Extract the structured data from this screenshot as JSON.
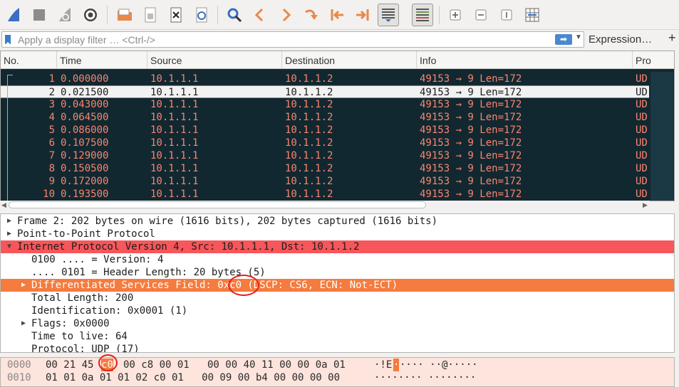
{
  "toolbar": {
    "buttons": [
      "shark-fin-start-icon",
      "stop-square-icon",
      "restart-fin-icon",
      "options-gear-icon",
      "open-folder-icon",
      "save-file-icon",
      "close-file-icon",
      "reload-icon",
      "find-magnifier-icon",
      "go-back-icon",
      "go-forward-icon",
      "go-to-packet-icon",
      "go-first-icon",
      "go-last-icon",
      "autoscroll-icon",
      "colorize-icon",
      "zoom-in-icon",
      "zoom-out-icon",
      "normal-size-icon",
      "resize-columns-icon"
    ]
  },
  "filter": {
    "placeholder": "Apply a display filter … <Ctrl-/>",
    "expression_label": "Expression…",
    "add_label": "+"
  },
  "packet_list": {
    "columns": [
      "No.",
      "Time",
      "Source",
      "Destination",
      "Info",
      "Pro"
    ],
    "rows": [
      {
        "no": "1",
        "time": "0.000000",
        "src": "10.1.1.1",
        "dst": "10.1.1.2",
        "info": "49153 → 9 Len=172",
        "proto": "UD"
      },
      {
        "no": "2",
        "time": "0.021500",
        "src": "10.1.1.1",
        "dst": "10.1.1.2",
        "info": "49153 → 9 Len=172",
        "proto": "UD"
      },
      {
        "no": "3",
        "time": "0.043000",
        "src": "10.1.1.1",
        "dst": "10.1.1.2",
        "info": "49153 → 9 Len=172",
        "proto": "UD"
      },
      {
        "no": "4",
        "time": "0.064500",
        "src": "10.1.1.1",
        "dst": "10.1.1.2",
        "info": "49153 → 9 Len=172",
        "proto": "UD"
      },
      {
        "no": "5",
        "time": "0.086000",
        "src": "10.1.1.1",
        "dst": "10.1.1.2",
        "info": "49153 → 9 Len=172",
        "proto": "UD"
      },
      {
        "no": "6",
        "time": "0.107500",
        "src": "10.1.1.1",
        "dst": "10.1.1.2",
        "info": "49153 → 9 Len=172",
        "proto": "UD"
      },
      {
        "no": "7",
        "time": "0.129000",
        "src": "10.1.1.1",
        "dst": "10.1.1.2",
        "info": "49153 → 9 Len=172",
        "proto": "UD"
      },
      {
        "no": "8",
        "time": "0.150500",
        "src": "10.1.1.1",
        "dst": "10.1.1.2",
        "info": "49153 → 9 Len=172",
        "proto": "UD"
      },
      {
        "no": "9",
        "time": "0.172000",
        "src": "10.1.1.1",
        "dst": "10.1.1.2",
        "info": "49153 → 9 Len=172",
        "proto": "UD"
      },
      {
        "no": "10",
        "time": "0.193500",
        "src": "10.1.1.1",
        "dst": "10.1.1.2",
        "info": "49153 → 9 Len=172",
        "proto": "UD"
      }
    ],
    "selected_no": "2"
  },
  "details": {
    "lines": [
      {
        "text": "Frame 2: 202 bytes on wire (1616 bits), 202 bytes captured (1616 bits)",
        "expander": "collapsed"
      },
      {
        "text": "Point-to-Point Protocol",
        "expander": "collapsed"
      },
      {
        "text": "Internet Protocol Version 4, Src: 10.1.1.1, Dst: 10.1.1.2",
        "expander": "expanded",
        "highlight": "red"
      },
      {
        "text": "0100 .... = Version: 4",
        "expander": "none"
      },
      {
        "text": ".... 0101 = Header Length: 20 bytes (5)",
        "expander": "none"
      },
      {
        "text": "Differentiated Services Field: 0xc0 (DSCP: CS6, ECN: Not-ECT)",
        "expander": "collapsed",
        "highlight": "orange"
      },
      {
        "text": "Total Length: 200",
        "expander": "none"
      },
      {
        "text": "Identification: 0x0001 (1)",
        "expander": "none"
      },
      {
        "text": "Flags: 0x0000",
        "expander": "collapsed"
      },
      {
        "text": "Time to live: 64",
        "expander": "none"
      },
      {
        "text": "Protocol: UDP (17)",
        "expander": "none"
      }
    ]
  },
  "bytes": {
    "rows": [
      {
        "offset": "0000",
        "hex_a": "00 21 45",
        "hex_sel": "c0",
        "hex_b": "00 c8 00 01   00 00 40 11 00 00 0a 01",
        "ascii_a": "·!E",
        "ascii_sel": "·",
        "ascii_b": "···· ··@·····"
      },
      {
        "offset": "0010",
        "hex_a": "01 01 0a 01 01 02 c0 01   00 09 00 b4 00 00 00 00",
        "hex_sel": "",
        "hex_b": "",
        "ascii_a": "········ ········",
        "ascii_sel": "",
        "ascii_b": ""
      }
    ]
  },
  "colors": {
    "list_bg": "#122830",
    "list_fg": "#f88570",
    "ip_highlight": "#f7565a",
    "field_highlight": "#f57b3e",
    "annotation_circle": "#e02020"
  }
}
